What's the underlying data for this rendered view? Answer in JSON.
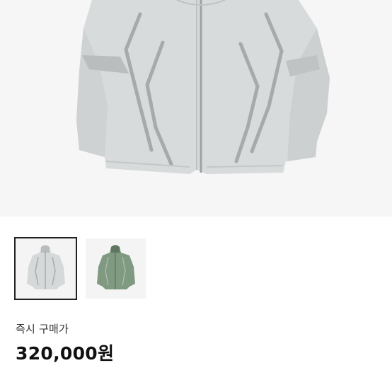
{
  "product": {
    "image_icon": "jacket-photo",
    "main_color": "#d7dadb",
    "thumbnails": [
      {
        "icon": "grey-jacket-thumbnail",
        "color": "#d6d9da",
        "selected": true
      },
      {
        "icon": "green-jacket-thumbnail",
        "color": "#7f9a80",
        "selected": false
      }
    ],
    "purchase_label": "즉시 구매가",
    "price": "320,000원"
  }
}
